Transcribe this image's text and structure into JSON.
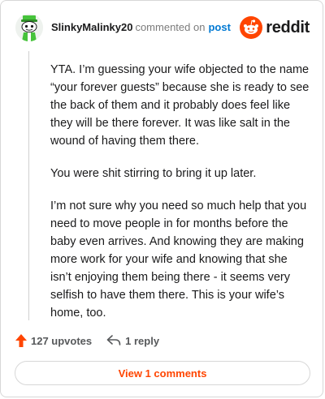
{
  "header": {
    "username": "SlinkyMalinky20",
    "action_text": "commented on",
    "post_link": "post",
    "logo_text": "reddit"
  },
  "comment": {
    "paragraphs": [
      "YTA. I’m guessing your wife objected to the name “your forever guests” because she is ready to see the back of them and it probably does feel like they will be there forever. It was like salt in the wound of having them there.",
      "You were shit stirring to bring it up later.",
      "I’m not sure why you need so much help that you need to move people in for months before the baby even arrives. And knowing they are making more work for your wife and knowing that she isn’t enjoying them being there - it seems very selfish to have them there. This is your wife’s home, too."
    ]
  },
  "actions": {
    "upvotes_label": "127 upvotes",
    "reply_label": "1 reply"
  },
  "footer": {
    "view_comments_label": "View 1 comments"
  },
  "colors": {
    "upvote_arrow": "#ff4500",
    "reddit_orange": "#ff4500",
    "link_blue": "#0079d3",
    "avatar_green": "#46c33b"
  },
  "icons": {
    "avatar": "snoo-avatar-icon",
    "logo": "reddit-logo-icon",
    "upvote": "upvote-arrow-icon",
    "reply": "reply-arrow-icon"
  }
}
